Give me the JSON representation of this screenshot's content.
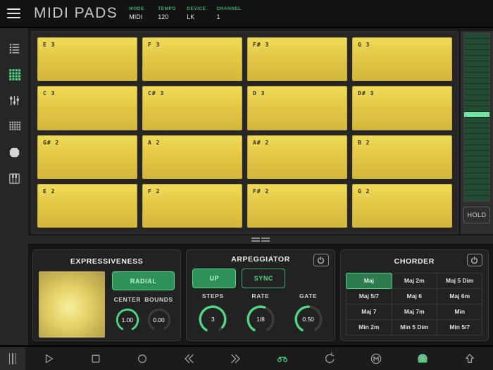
{
  "topbar": {
    "title": "MIDI PADS",
    "fields": [
      {
        "label": "MODE",
        "value": "MIDI"
      },
      {
        "label": "TEMPO",
        "value": "120"
      },
      {
        "label": "DEVICE",
        "value": "LK"
      },
      {
        "label": "CHANNEL",
        "value": "1"
      }
    ]
  },
  "sidebar": {
    "icons": [
      "list-menu",
      "pads-grid",
      "faders",
      "step-grid",
      "hexagon",
      "piano-keys"
    ],
    "active_icon": "pads-grid"
  },
  "pads": {
    "labels": [
      "E 3",
      "F 3",
      "F# 3",
      "G 3",
      "C 3",
      "C# 3",
      "D 3",
      "D# 3",
      "G# 2",
      "A 2",
      "A# 2",
      "B 2",
      "E 2",
      "F 2",
      "F# 2",
      "G 2"
    ]
  },
  "meter": {
    "segment_count": 30,
    "active_index": 14,
    "hold_label": "HOLD"
  },
  "panels": {
    "expressiveness": {
      "title": "EXPRESSIVENESS",
      "radial_label": "RADIAL",
      "center": {
        "label": "CENTER",
        "value": "1.00",
        "frac": 1
      },
      "bounds": {
        "label": "BOUNDS",
        "value": "0.00",
        "frac": 0
      }
    },
    "arpeggiator": {
      "title": "ARPEGGIATOR",
      "up_label": "UP",
      "sync_label": "SYNC",
      "steps": {
        "label": "STEPS",
        "value": "3",
        "frac": 0.93
      },
      "rate": {
        "label": "RATE",
        "value": "1/8",
        "frac": 0.56
      },
      "gate": {
        "label": "GATE",
        "value": "0.50",
        "frac": 0.5
      }
    },
    "chorder": {
      "title": "CHORDER",
      "chords": [
        {
          "label": "Maj",
          "active": true
        },
        {
          "label": "Maj 2m",
          "active": false
        },
        {
          "label": "Maj 5 Dim",
          "active": false
        },
        {
          "label": "Maj 5/7",
          "active": false
        },
        {
          "label": "Maj 6",
          "active": false
        },
        {
          "label": "Maj 6m",
          "active": false
        },
        {
          "label": "Maj 7",
          "active": false
        },
        {
          "label": "Maj 7m",
          "active": false
        },
        {
          "label": "Min",
          "active": false
        },
        {
          "label": "Min 2m",
          "active": false
        },
        {
          "label": "Min 5 Dim",
          "active": false
        },
        {
          "label": "Min 5/7",
          "active": false
        }
      ]
    }
  },
  "toolbar": {
    "icons": [
      "drag-handle",
      "play",
      "stop",
      "record",
      "rewind",
      "fast-forward",
      "loop",
      "undo",
      "metronome-m",
      "midi-din",
      "shift-up"
    ]
  },
  "colors": {
    "accent_green": "#4fd584",
    "pad_yellow": "#e3c847"
  }
}
